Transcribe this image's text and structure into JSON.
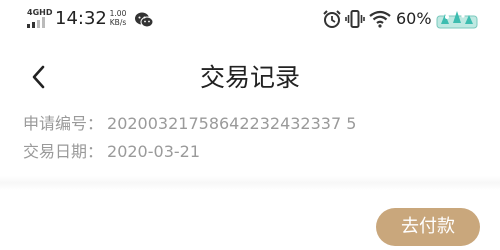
{
  "status_bar": {
    "network_type": "4GHD",
    "time": "14:32",
    "speed_value": "1.00",
    "speed_unit": "KB/s",
    "battery_percent": "60%",
    "icons": [
      "signal-icon",
      "wechat-icon",
      "alarm-icon",
      "vibrate-icon",
      "wifi-icon",
      "battery-icon"
    ]
  },
  "nav": {
    "title": "交易记录",
    "back_icon": "chevron-left-icon"
  },
  "record": {
    "order_label": "申请编号：",
    "order_value": "20200321758642232432337 5",
    "date_label": "交易日期：",
    "date_value": "2020-03-21"
  },
  "actions": {
    "pay_label": "去付款"
  },
  "colors": {
    "accent": "#c9a77c",
    "label_gray": "#9a9a9a"
  }
}
